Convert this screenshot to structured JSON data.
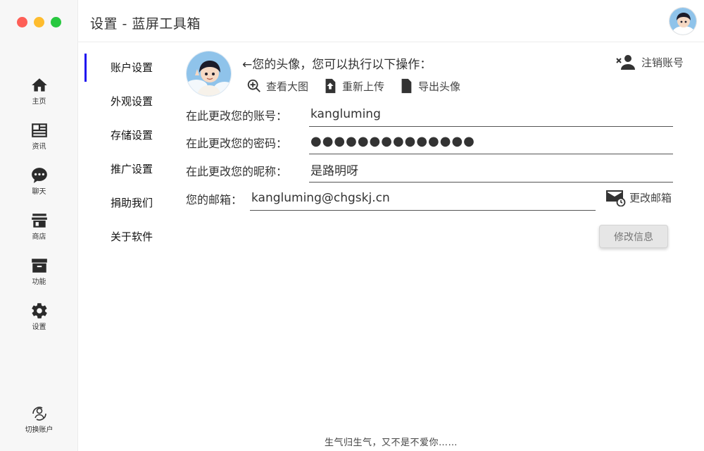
{
  "window": {
    "title": "设置 - 蓝屏工具箱",
    "controls": [
      "close",
      "minimize",
      "maximize"
    ],
    "colors": {
      "close": "#fe5f57",
      "minimize": "#febc2e",
      "maximize": "#28c840"
    }
  },
  "sidebar": {
    "items": [
      {
        "label": "主页",
        "icon": "home-icon"
      },
      {
        "label": "资讯",
        "icon": "news-icon"
      },
      {
        "label": "聊天",
        "icon": "chat-icon"
      },
      {
        "label": "商店",
        "icon": "store-icon"
      },
      {
        "label": "功能",
        "icon": "archive-icon"
      },
      {
        "label": "设置",
        "icon": "gear-icon"
      }
    ],
    "switch_account": {
      "label": "切换账户",
      "icon": "switch-account-icon"
    }
  },
  "settings_nav": {
    "active_index": 0,
    "accent_color": "#1f12f0",
    "items": [
      "账户设置",
      "外观设置",
      "存储设置",
      "推广设置",
      "捐助我们",
      "关于软件"
    ]
  },
  "account": {
    "avatar_hint": "←您的头像，您可以执行以下操作：",
    "logout_label": "注销账号",
    "actions": [
      {
        "label": "查看大图",
        "icon": "zoom-in-icon"
      },
      {
        "label": "重新上传",
        "icon": "upload-icon"
      },
      {
        "label": "导出头像",
        "icon": "export-icon"
      }
    ],
    "fields": {
      "username": {
        "label": "在此更改您的账号：",
        "value": "kangluming"
      },
      "password": {
        "label": "在此更改您的密码：",
        "value": "●●●●●●●●●●●●●●"
      },
      "nickname": {
        "label": "在此更改您的昵称：",
        "value": "是路明呀"
      },
      "email": {
        "label": "您的邮箱：",
        "value": "kangluming@chgskj.cn"
      }
    },
    "change_email_label": "更改邮箱",
    "submit_label": "修改信息"
  },
  "footer": {
    "text": "生气归生气，又不是不爱你……"
  }
}
